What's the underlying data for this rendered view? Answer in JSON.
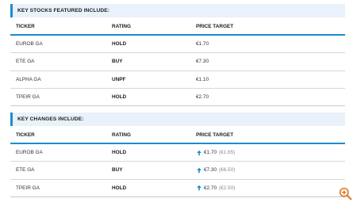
{
  "section1": {
    "title": "KEY STOCKS FEATURED INCLUDE:",
    "headers": {
      "ticker": "TICKER",
      "rating": "RATING",
      "target": "PRICE TARGET"
    },
    "rows": [
      {
        "ticker": "EUROB GA",
        "rating": "HOLD",
        "target": "€1.70"
      },
      {
        "ticker": "ETE GA",
        "rating": "BUY",
        "target": "€7.30"
      },
      {
        "ticker": "ALPHA GA",
        "rating": "UNPF",
        "target": "€1.10"
      },
      {
        "ticker": "TPEIR GA",
        "rating": "HOLD",
        "target": "€2.70"
      }
    ]
  },
  "section2": {
    "title": "KEY CHANGES INCLUDE:",
    "headers": {
      "ticker": "TICKER",
      "rating": "RATING",
      "target": "PRICE TARGET"
    },
    "rows": [
      {
        "ticker": "EUROB GA",
        "rating": "HOLD",
        "target": "€1.70",
        "previous": "(€1.65)",
        "direction": "up"
      },
      {
        "ticker": "ETE GA",
        "rating": "BUY",
        "target": "€7.30",
        "previous": "(€6.50)",
        "direction": "up"
      },
      {
        "ticker": "TPEIR GA",
        "rating": "HOLD",
        "target": "€2.70",
        "previous": "(€2.50)",
        "direction": "up"
      }
    ]
  },
  "colors": {
    "accent": "#1a8ecf",
    "header_bg": "#e9f2fa",
    "zoom": "#e07b28"
  },
  "icons": {
    "arrow": "arrow-up-icon",
    "zoom": "zoom-in-icon"
  }
}
